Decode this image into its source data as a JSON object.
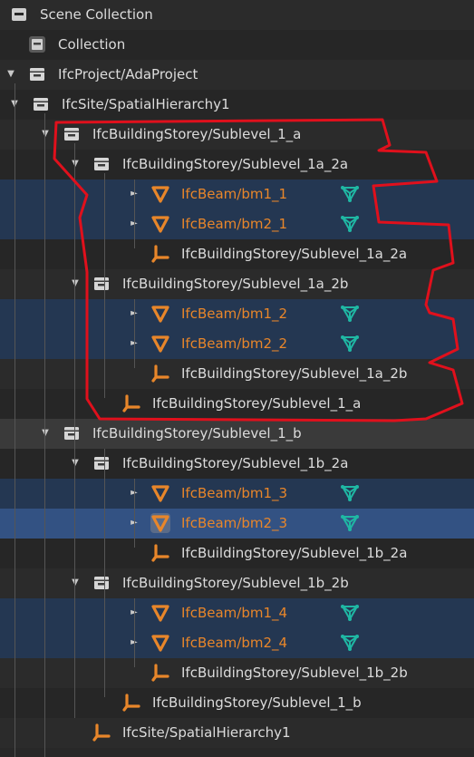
{
  "colors": {
    "background": "#282828",
    "selected_row": "#243752",
    "active_row": "#335283",
    "object_text": "#e8862a",
    "mesh_data_icon": "#1fb8a4",
    "annotation": "#e0101c"
  },
  "rows": [
    {
      "label": "Scene Collection",
      "icon": "scene-collection-icon",
      "type": "collection"
    },
    {
      "label": "Collection",
      "icon": "collection-box-icon",
      "type": "collection"
    },
    {
      "label": "IfcProject/AdaProject",
      "icon": "collection-icon",
      "type": "collection",
      "expanded": true
    },
    {
      "label": "IfcSite/SpatialHierarchy1",
      "icon": "collection-icon",
      "type": "collection",
      "expanded": true
    },
    {
      "label": "IfcBuildingStorey/Sublevel_1_a",
      "icon": "collection-icon",
      "type": "collection",
      "expanded": true
    },
    {
      "label": "IfcBuildingStorey/Sublevel_1a_2a",
      "icon": "collection-icon",
      "type": "collection",
      "expanded": true
    },
    {
      "label": "IfcBeam/bm1_1",
      "icon": "mesh-object-icon",
      "type": "object",
      "data_icon": "mesh-data-icon"
    },
    {
      "label": "IfcBeam/bm2_1",
      "icon": "mesh-object-icon",
      "type": "object",
      "data_icon": "mesh-data-icon"
    },
    {
      "label": "IfcBuildingStorey/Sublevel_1a_2a",
      "icon": "empty-object-icon",
      "type": "empty"
    },
    {
      "label": "IfcBuildingStorey/Sublevel_1a_2b",
      "icon": "collection-icon",
      "type": "collection",
      "expanded": true
    },
    {
      "label": "IfcBeam/bm1_2",
      "icon": "mesh-object-icon",
      "type": "object",
      "data_icon": "mesh-data-icon"
    },
    {
      "label": "IfcBeam/bm2_2",
      "icon": "mesh-object-icon",
      "type": "object",
      "data_icon": "mesh-data-icon"
    },
    {
      "label": "IfcBuildingStorey/Sublevel_1a_2b",
      "icon": "empty-object-icon",
      "type": "empty"
    },
    {
      "label": "IfcBuildingStorey/Sublevel_1_a",
      "icon": "empty-object-icon",
      "type": "empty"
    },
    {
      "label": "IfcBuildingStorey/Sublevel_1_b",
      "icon": "collection-icon",
      "type": "collection",
      "expanded": true
    },
    {
      "label": "IfcBuildingStorey/Sublevel_1b_2a",
      "icon": "collection-icon",
      "type": "collection",
      "expanded": true
    },
    {
      "label": "IfcBeam/bm1_3",
      "icon": "mesh-object-icon",
      "type": "object",
      "data_icon": "mesh-data-icon"
    },
    {
      "label": "IfcBeam/bm2_3",
      "icon": "mesh-object-icon",
      "type": "object",
      "data_icon": "mesh-data-icon",
      "active": true
    },
    {
      "label": "IfcBuildingStorey/Sublevel_1b_2a",
      "icon": "empty-object-icon",
      "type": "empty"
    },
    {
      "label": "IfcBuildingStorey/Sublevel_1b_2b",
      "icon": "collection-icon",
      "type": "collection",
      "expanded": true
    },
    {
      "label": "IfcBeam/bm1_4",
      "icon": "mesh-object-icon",
      "type": "object",
      "data_icon": "mesh-data-icon"
    },
    {
      "label": "IfcBeam/bm2_4",
      "icon": "mesh-object-icon",
      "type": "object",
      "data_icon": "mesh-data-icon"
    },
    {
      "label": "IfcBuildingStorey/Sublevel_1b_2b",
      "icon": "empty-object-icon",
      "type": "empty"
    },
    {
      "label": "IfcBuildingStorey/Sublevel_1_b",
      "icon": "empty-object-icon",
      "type": "empty"
    },
    {
      "label": "IfcSite/SpatialHierarchy1",
      "icon": "empty-object-icon",
      "type": "empty"
    }
  ]
}
